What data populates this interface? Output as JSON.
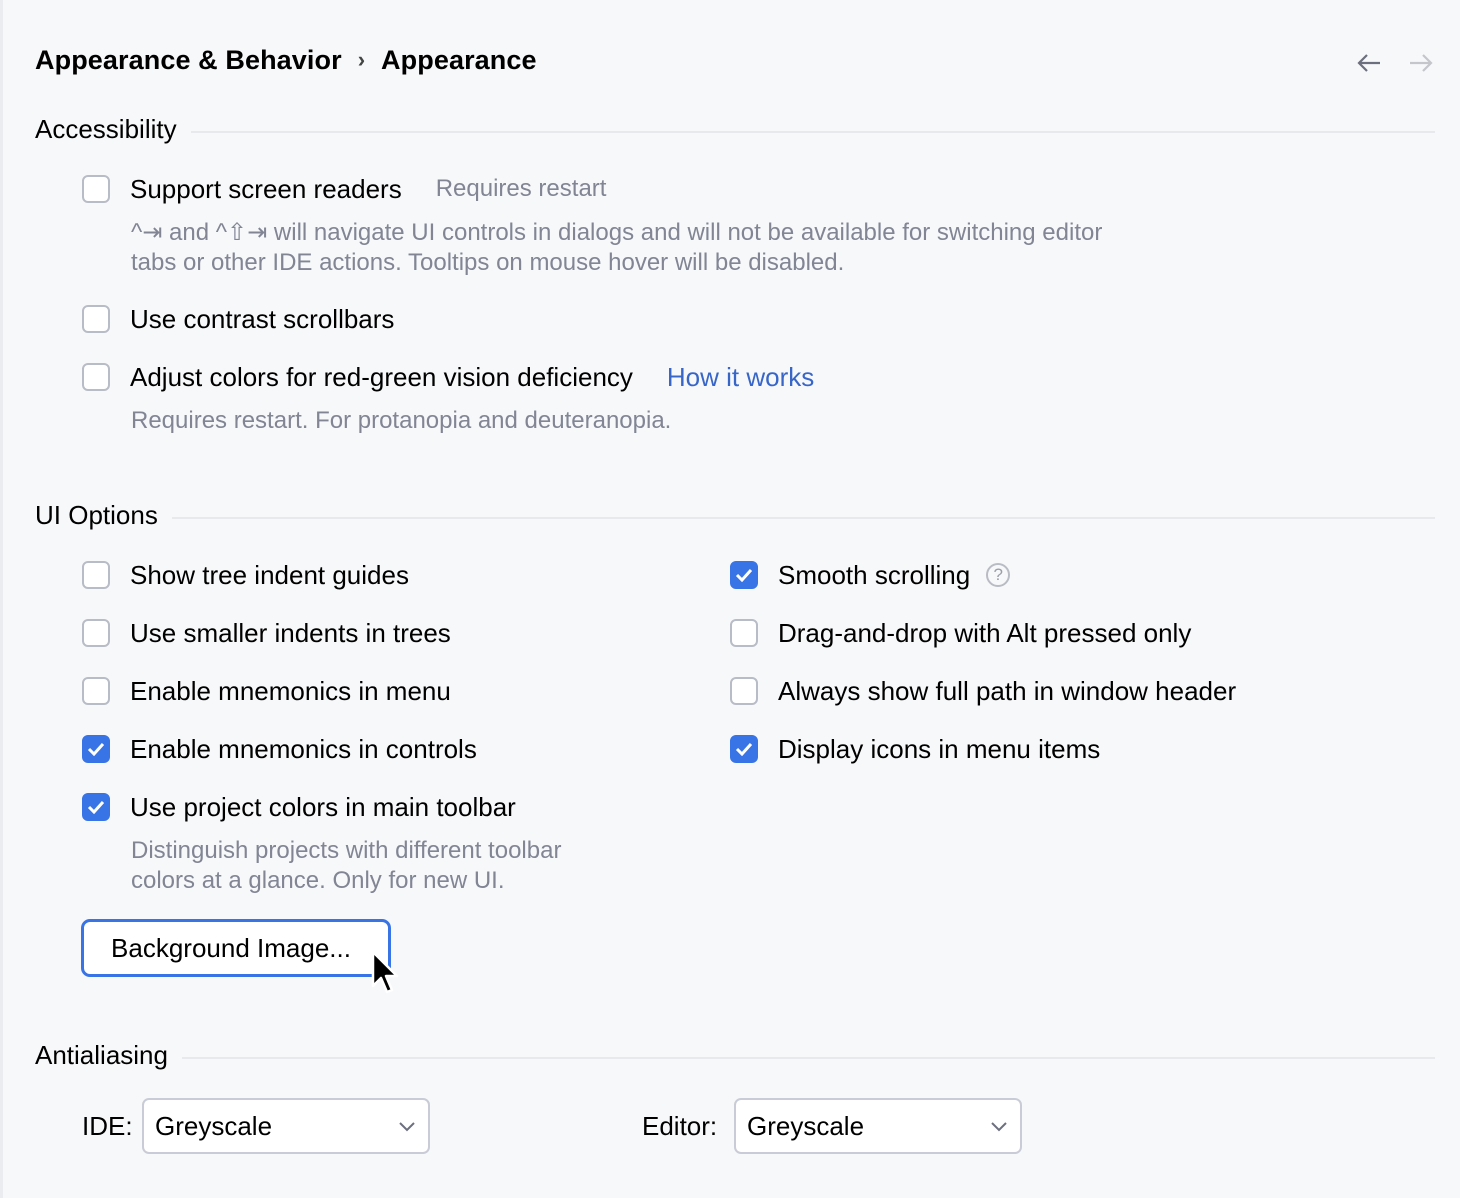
{
  "breadcrumb": {
    "parent": "Appearance & Behavior",
    "separator": "›",
    "current": "Appearance"
  },
  "nav": {
    "back_icon": "arrow-left-icon",
    "forward_icon": "arrow-right-icon",
    "forward_enabled": false
  },
  "accessibility": {
    "title": "Accessibility",
    "screen_readers": {
      "label": "Support screen readers",
      "checked": false,
      "hint": "Requires restart",
      "desc_line1": "^⇥ and ^⇧⇥ will navigate UI controls in dialogs and will not be available for switching editor",
      "desc_line2": "tabs or other IDE actions. Tooltips on mouse hover will be disabled."
    },
    "contrast_scrollbars": {
      "label": "Use contrast scrollbars",
      "checked": false
    },
    "color_deficiency": {
      "label": "Adjust colors for red-green vision deficiency",
      "checked": false,
      "link": "How it works",
      "desc": "Requires restart. For protanopia and deuteranopia."
    }
  },
  "ui_options": {
    "title": "UI Options",
    "left": [
      {
        "label": "Show tree indent guides",
        "checked": false
      },
      {
        "label": "Use smaller indents in trees",
        "checked": false
      },
      {
        "label": "Enable mnemonics in menu",
        "checked": false
      },
      {
        "label": "Enable mnemonics in controls",
        "checked": true
      },
      {
        "label": "Use project colors in main toolbar",
        "checked": true
      }
    ],
    "right": [
      {
        "label": "Smooth scrolling",
        "checked": true,
        "help_icon": "?"
      },
      {
        "label": "Drag-and-drop with Alt pressed only",
        "checked": false
      },
      {
        "label": "Always show full path in window header",
        "checked": false
      },
      {
        "label": "Display icons in menu items",
        "checked": true
      }
    ],
    "project_colors_desc_line1": "Distinguish projects with different toolbar",
    "project_colors_desc_line2": "colors at a glance. Only for new UI.",
    "background_image_button": "Background Image..."
  },
  "antialiasing": {
    "title": "Antialiasing",
    "ide_label": "IDE:",
    "ide_value": "Greyscale",
    "editor_label": "Editor:",
    "editor_value": "Greyscale"
  },
  "colors": {
    "accent": "#3874e6",
    "link": "#3866c8",
    "hint": "#818594",
    "background": "#f7f8fa"
  }
}
